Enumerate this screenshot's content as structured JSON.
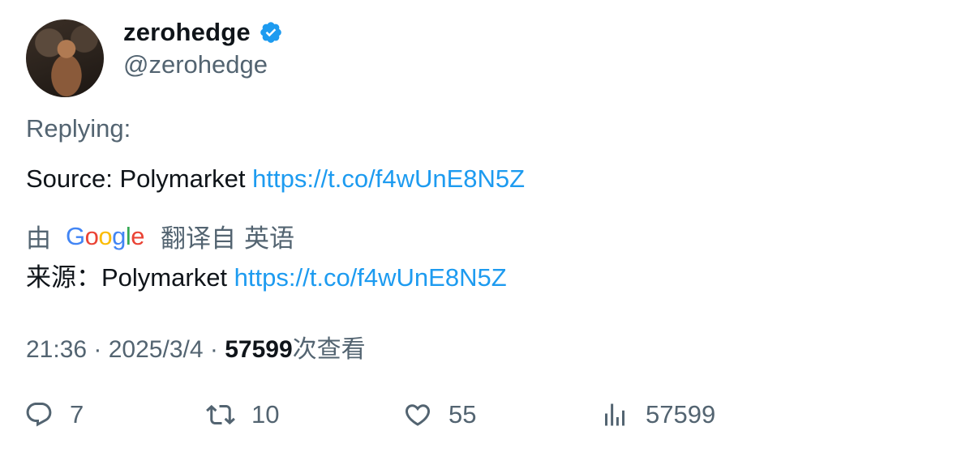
{
  "author": {
    "display_name": "zerohedge",
    "handle": "@zerohedge",
    "verified": true
  },
  "replying_label": "Replying:",
  "tweet": {
    "text_prefix": "Source: Polymarket ",
    "link": "https://t.co/f4wUnE8N5Z"
  },
  "translation": {
    "by_label": "由",
    "google_letters": [
      {
        "char": "G",
        "color": "#4285F4"
      },
      {
        "char": "o",
        "color": "#EA4335"
      },
      {
        "char": "o",
        "color": "#FBBC05"
      },
      {
        "char": "g",
        "color": "#4285F4"
      },
      {
        "char": "l",
        "color": "#34A853"
      },
      {
        "char": "e",
        "color": "#EA4335"
      }
    ],
    "translated_from": "翻译自",
    "language": "英语",
    "text_prefix": "来源：Polymarket ",
    "link": "https://t.co/f4wUnE8N5Z"
  },
  "meta": {
    "time": "21:36",
    "sep1": " · ",
    "date": "2025/3/4",
    "sep2": " · ",
    "views_count": "57599",
    "views_label": "次查看"
  },
  "actions": {
    "replies": "7",
    "retweets": "10",
    "likes": "55",
    "views": "57599"
  },
  "colors": {
    "accent": "#1d9bf0",
    "secondary_text": "#536471",
    "primary_text": "#0f1419"
  }
}
